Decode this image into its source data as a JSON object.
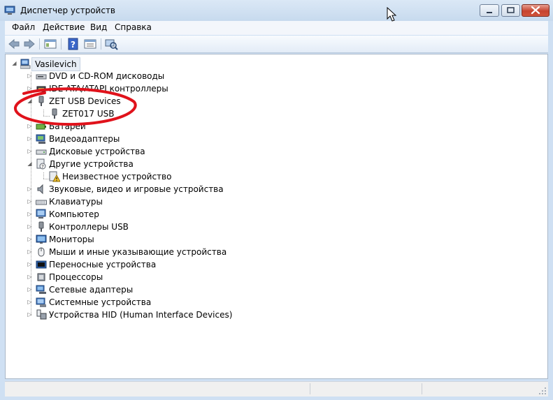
{
  "window": {
    "title": "Диспетчер устройств",
    "controls": {
      "minimize_icon": "minimize-icon",
      "maximize_icon": "maximize-icon",
      "close_icon": "close-icon"
    },
    "accent": "#c6432e"
  },
  "menubar": {
    "items": [
      {
        "label": "Файл"
      },
      {
        "label": "Действие"
      },
      {
        "label": "Вид"
      },
      {
        "label": "Справка"
      }
    ]
  },
  "toolbar": {
    "buttons": [
      {
        "icon": "back-arrow-icon"
      },
      {
        "icon": "forward-arrow-icon"
      },
      {
        "icon": "show-hide-console-tree-icon"
      },
      {
        "icon": "help-icon"
      },
      {
        "icon": "properties-icon"
      },
      {
        "icon": "scan-hardware-icon"
      }
    ]
  },
  "tree": {
    "root": {
      "label": "Vasilevich",
      "icon": "computer-icon",
      "expanded": true
    },
    "items": [
      {
        "label": "DVD и CD-ROM дисководы",
        "icon": "dvd-drive-icon",
        "expanded": false
      },
      {
        "label": "IDE ATA/ATAPI контроллеры",
        "icon": "ide-controller-icon",
        "expanded": false
      },
      {
        "label": "ZET USB Devices",
        "icon": "usb-plug-icon",
        "expanded": true,
        "children": [
          {
            "label": "ZET017 USB",
            "icon": "usb-plug-icon"
          }
        ]
      },
      {
        "label": "Батареи",
        "icon": "battery-icon",
        "expanded": false
      },
      {
        "label": "Видеоадаптеры",
        "icon": "display-adapter-icon",
        "expanded": false
      },
      {
        "label": "Дисковые устройства",
        "icon": "disk-drive-icon",
        "expanded": false
      },
      {
        "label": "Другие устройства",
        "icon": "unknown-device-icon",
        "expanded": true,
        "children": [
          {
            "label": "Неизвестное устройство",
            "icon": "warning-device-icon"
          }
        ]
      },
      {
        "label": "Звуковые, видео и игровые устройства",
        "icon": "speaker-icon",
        "expanded": false
      },
      {
        "label": "Клавиатуры",
        "icon": "keyboard-icon",
        "expanded": false
      },
      {
        "label": "Компьютер",
        "icon": "computer-icon",
        "expanded": false
      },
      {
        "label": "Контроллеры USB",
        "icon": "usb-plug-icon",
        "expanded": false
      },
      {
        "label": "Мониторы",
        "icon": "monitor-icon",
        "expanded": false
      },
      {
        "label": "Мыши и иные указывающие устройства",
        "icon": "mouse-icon",
        "expanded": false
      },
      {
        "label": "Переносные устройства",
        "icon": "portable-device-icon",
        "expanded": false
      },
      {
        "label": "Процессоры",
        "icon": "processor-icon",
        "expanded": false
      },
      {
        "label": "Сетевые адаптеры",
        "icon": "network-adapter-icon",
        "expanded": false
      },
      {
        "label": "Системные устройства",
        "icon": "system-device-icon",
        "expanded": false
      },
      {
        "label": "Устройства HID (Human Interface Devices)",
        "icon": "hid-device-icon",
        "expanded": false
      }
    ]
  },
  "annotation": {
    "color": "#e0121b"
  }
}
